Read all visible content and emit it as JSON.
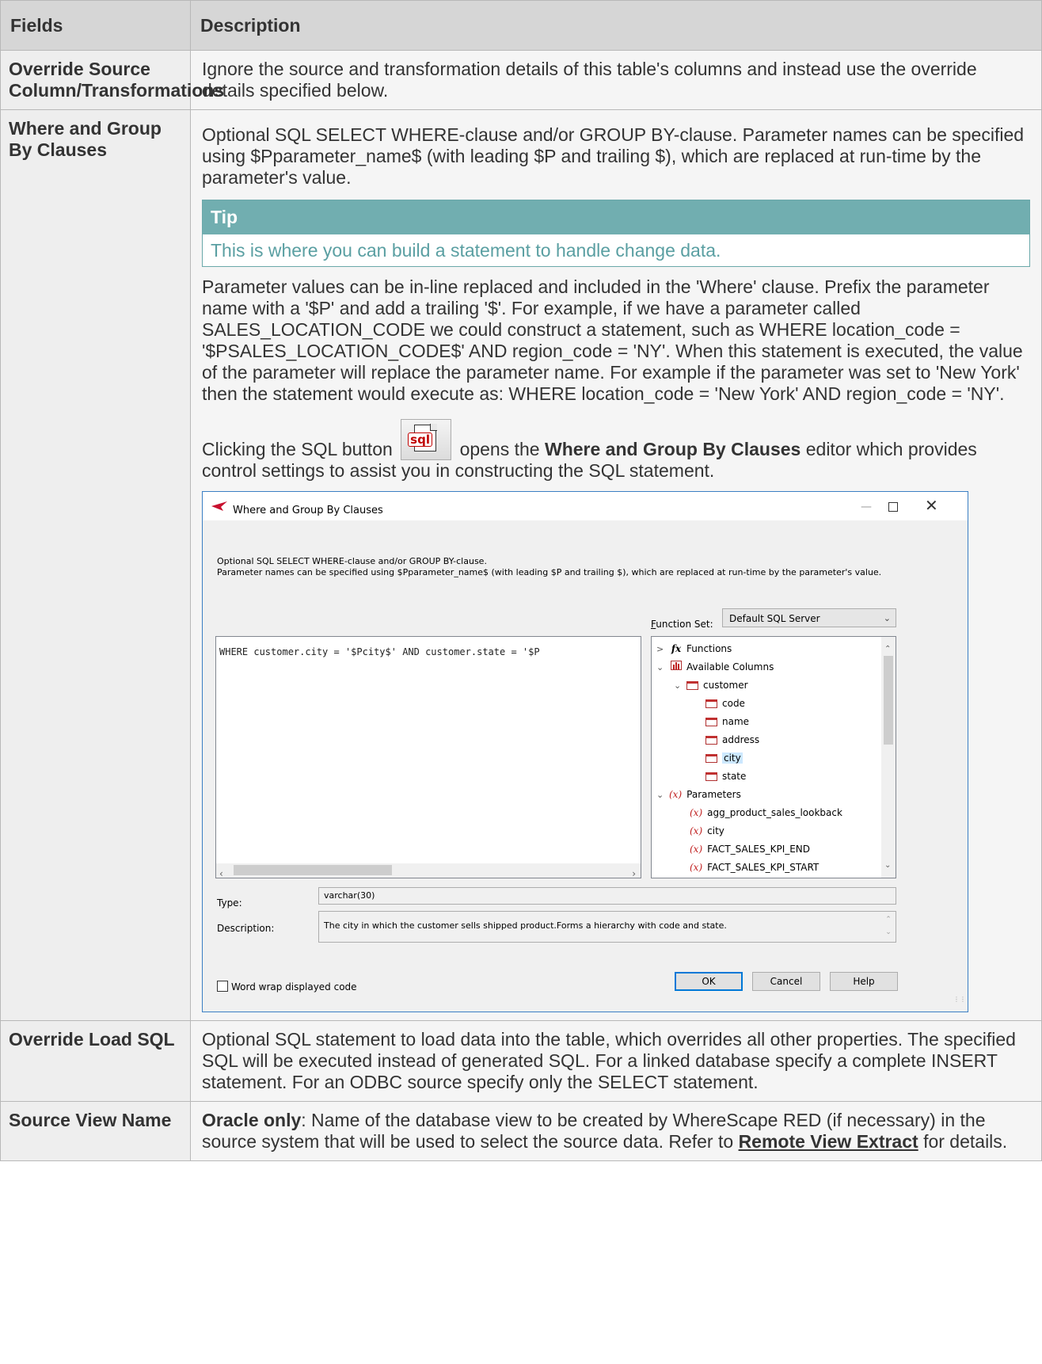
{
  "table": {
    "headers": {
      "fields": "Fields",
      "description": "Description"
    },
    "rows": {
      "override_source": {
        "field": "Override Source Column/Transformations",
        "description": "Ignore the source and transformation details of this table's columns and instead use the override details specified below."
      },
      "where_group": {
        "field": "Where and Group By Clauses",
        "description": "Optional SQL SELECT WHERE-clause and/or GROUP BY-clause. Parameter names can be specified using $Pparameter_name$ (with leading $P and trailing $), which are replaced at run-time by the parameter's value.",
        "tip_title": "Tip",
        "tip_text": "This is where you can build a statement to handle change data.",
        "param_paragraph": "Parameter values can be in-line replaced and included in the 'Where' clause. Prefix the parameter name with a '$P' and add a trailing '$'. For example, if we have a parameter called SALES_LOCATION_CODE we could construct a statement, such as WHERE location_code = '$PSALES_LOCATION_CODE$' AND region_code = 'NY'. When this statement is executed, the value of the parameter will replace the parameter name. For example if the parameter was set to 'New York' then the statement would execute as: WHERE location_code = 'New York' AND region_code = 'NY'.",
        "sql_text_before": "Clicking the SQL button",
        "sql_text_after": "opens the",
        "sql_text_bold": "Where and Group By Clauses",
        "sql_text_end": "editor which provides control settings to assist you in constructing the SQL statement.",
        "sql_button_icon": "sql-document-icon"
      },
      "override_load": {
        "field": "Override Load SQL",
        "description": "Optional SQL statement to load data into the table, which overrides all other properties. The specified SQL will be executed instead of generated SQL. For a linked database specify a complete INSERT statement. For an ODBC source specify only the SELECT statement."
      },
      "source_view": {
        "field": "Source View Name",
        "bold_prefix": "Oracle only",
        "description": ": Name of the database view to be created by WhereScape RED (if necessary) in the source system that will be used to select the source data. Refer to",
        "link_text": "Remote View Extract",
        "description_end": "for details."
      }
    }
  },
  "dialog": {
    "title": "Where and Group By Clauses",
    "window_controls": {
      "minimize": "—",
      "close": "✕"
    },
    "description_line1": "Optional SQL SELECT WHERE-clause and/or GROUP BY-clause.",
    "description_line2": "Parameter names can be specified using $Pparameter_name$ (with leading $P and trailing $), which are replaced at run-time by the parameter's value.",
    "function_set_label": "Function Set:",
    "function_set_value": "Default SQL Server",
    "editor_code": "WHERE customer.city = '$Pcity$' AND customer.state = '$P",
    "tree": {
      "functions": "Functions",
      "available_columns": "Available Columns",
      "table": "customer",
      "columns": [
        "code",
        "name",
        "address",
        "city",
        "state"
      ],
      "selected_column": "city",
      "parameters_label": "Parameters",
      "parameters": [
        "agg_product_sales_lookback",
        "city",
        "FACT_SALES_KPI_END",
        "FACT_SALES_KPI_START"
      ]
    },
    "type_label": "Type:",
    "type_value": "varchar(30)",
    "description_label": "Description:",
    "description_value": "The city in which the customer sells shipped product.Forms a hierarchy with code and state.",
    "word_wrap_label": "Word wrap displayed code",
    "buttons": {
      "ok": "OK",
      "cancel": "Cancel",
      "help": "Help"
    },
    "accent_color": "#0078d7"
  }
}
